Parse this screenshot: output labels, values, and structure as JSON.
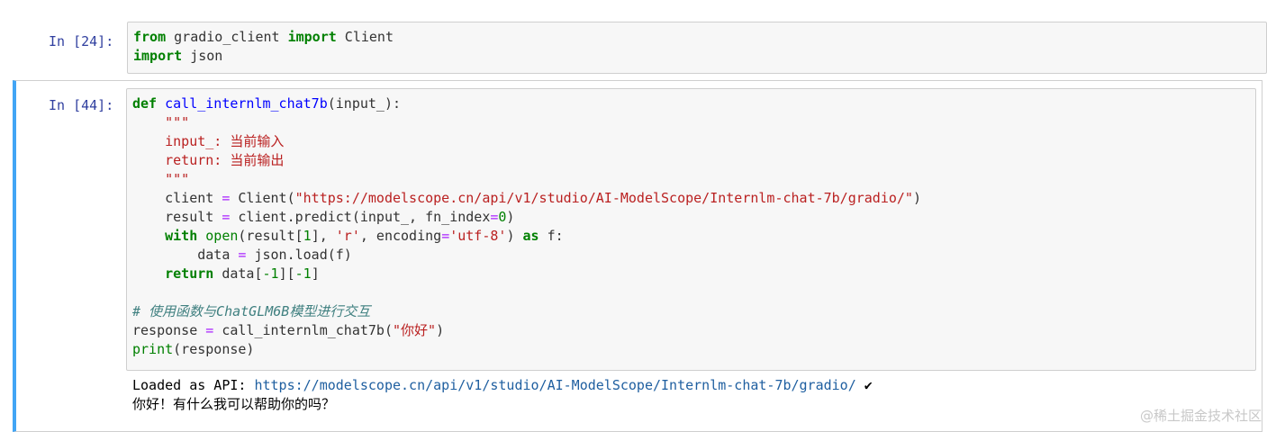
{
  "cells": [
    {
      "prompt": "In  [24]:",
      "code_lines": [
        [
          {
            "t": "from",
            "c": "kw"
          },
          {
            "t": " gradio_client ",
            "c": ""
          },
          {
            "t": "import",
            "c": "kw"
          },
          {
            "t": " Client",
            "c": ""
          }
        ],
        [
          {
            "t": "import",
            "c": "kw"
          },
          {
            "t": " json",
            "c": ""
          }
        ]
      ]
    },
    {
      "prompt": "In  [44]:",
      "code_lines": [
        [
          {
            "t": "def",
            "c": "kw"
          },
          {
            "t": " ",
            "c": ""
          },
          {
            "t": "call_internlm_chat7b",
            "c": "fn"
          },
          {
            "t": "(input_):",
            "c": ""
          }
        ],
        [
          {
            "t": "    \"\"\"",
            "c": "str"
          }
        ],
        [
          {
            "t": "    input_: 当前输入",
            "c": "str"
          }
        ],
        [
          {
            "t": "    return: 当前输出",
            "c": "str"
          }
        ],
        [
          {
            "t": "    \"\"\"",
            "c": "str"
          }
        ],
        [
          {
            "t": "    client ",
            "c": ""
          },
          {
            "t": "=",
            "c": "op"
          },
          {
            "t": " Client(",
            "c": ""
          },
          {
            "t": "\"https://modelscope.cn/api/v1/studio/AI-ModelScope/Internlm-chat-7b/gradio/\"",
            "c": "str"
          },
          {
            "t": ")",
            "c": ""
          }
        ],
        [
          {
            "t": "    result ",
            "c": ""
          },
          {
            "t": "=",
            "c": "op"
          },
          {
            "t": " client.predict(input_, fn_index",
            "c": ""
          },
          {
            "t": "=",
            "c": "op"
          },
          {
            "t": "0",
            "c": "num"
          },
          {
            "t": ")",
            "c": ""
          }
        ],
        [
          {
            "t": "    ",
            "c": ""
          },
          {
            "t": "with",
            "c": "kw"
          },
          {
            "t": " ",
            "c": ""
          },
          {
            "t": "open",
            "c": "bi"
          },
          {
            "t": "(result[",
            "c": ""
          },
          {
            "t": "1",
            "c": "num"
          },
          {
            "t": "], ",
            "c": ""
          },
          {
            "t": "'r'",
            "c": "str"
          },
          {
            "t": ", encoding",
            "c": ""
          },
          {
            "t": "=",
            "c": "op"
          },
          {
            "t": "'utf-8'",
            "c": "str"
          },
          {
            "t": ") ",
            "c": ""
          },
          {
            "t": "as",
            "c": "kw"
          },
          {
            "t": " f:",
            "c": ""
          }
        ],
        [
          {
            "t": "        data ",
            "c": ""
          },
          {
            "t": "=",
            "c": "op"
          },
          {
            "t": " json.load(f)",
            "c": ""
          }
        ],
        [
          {
            "t": "    ",
            "c": ""
          },
          {
            "t": "return",
            "c": "kw"
          },
          {
            "t": " data[",
            "c": ""
          },
          {
            "t": "-1",
            "c": "num"
          },
          {
            "t": "][",
            "c": ""
          },
          {
            "t": "-1",
            "c": "num"
          },
          {
            "t": "]",
            "c": ""
          }
        ],
        [
          {
            "t": "",
            "c": ""
          }
        ],
        [
          {
            "t": "# 使用函数与ChatGLM6B模型进行交互",
            "c": "cmt"
          }
        ],
        [
          {
            "t": "response ",
            "c": ""
          },
          {
            "t": "=",
            "c": "op"
          },
          {
            "t": " call_internlm_chat7b(",
            "c": ""
          },
          {
            "t": "\"你好\"",
            "c": "str"
          },
          {
            "t": ")",
            "c": ""
          }
        ],
        [
          {
            "t": "print",
            "c": "bi"
          },
          {
            "t": "(response)",
            "c": ""
          }
        ]
      ],
      "output": {
        "loaded_prefix": "Loaded as API: ",
        "loaded_url": "https://modelscope.cn/api/v1/studio/AI-ModelScope/Internlm-chat-7b/gradio/",
        "check": " ✔",
        "response": "你好！有什么我可以帮助你的吗？"
      }
    }
  ],
  "watermark": "@稀土掘金技术社区",
  "colors": {
    "active_cell_border": "#42a5f5",
    "prompt": "#303f9f",
    "keyword": "#008000",
    "string": "#ba2121",
    "comment": "#408080"
  }
}
